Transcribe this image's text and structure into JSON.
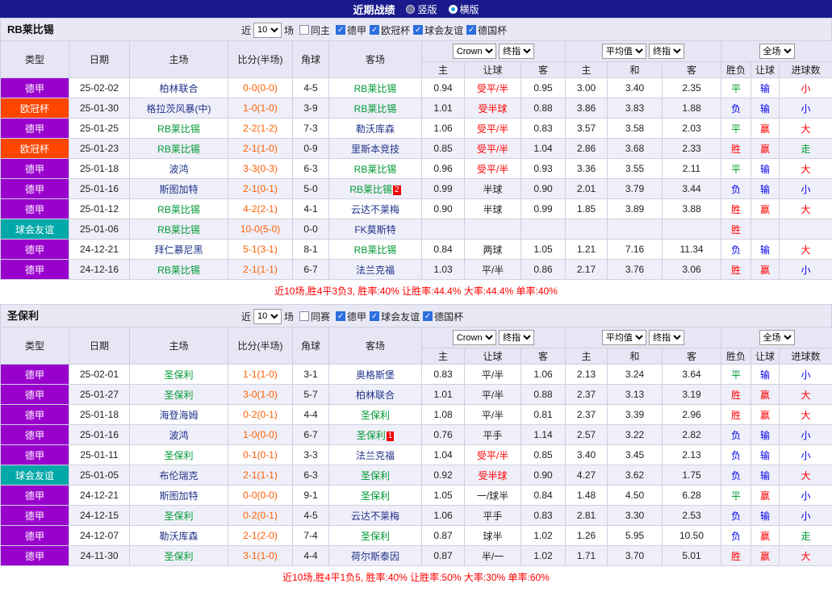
{
  "topbar": {
    "title": "近期战绩",
    "vertical": "竖版",
    "horizontal": "横版"
  },
  "league_colors": {
    "德甲": "#9900CC",
    "欧冠杯": "#FF4500",
    "球会友谊": "#00A8A8"
  },
  "headers": {
    "league": "类型",
    "date": "日期",
    "home": "主场",
    "score": "比分(半场)",
    "corner": "角球",
    "away": "客场",
    "a_home": "主",
    "a_handicap": "让球",
    "a_away": "客",
    "e_home": "主",
    "e_draw": "和",
    "e_away": "客",
    "res": "胜负",
    "hres": "让球",
    "goal": "进球数"
  },
  "sections": [
    {
      "team": "RB莱比锡",
      "filter": {
        "near": "近",
        "count": "10",
        "games": "场",
        "same": "同主",
        "same_checked": false,
        "leagues": [
          {
            "label": "德甲",
            "checked": true
          },
          {
            "label": "欧冠杯",
            "checked": true
          },
          {
            "label": "球会友谊",
            "checked": true
          },
          {
            "label": "德国杯",
            "checked": true
          }
        ]
      },
      "selects": {
        "bookmaker": "Crown",
        "bk_mode": "终指",
        "euro": "平均值",
        "euro_mode": "终指",
        "scope": "全场"
      },
      "rows": [
        {
          "league": "德甲",
          "date": "25-02-02",
          "home": "柏林联合",
          "home_focus": false,
          "home_badge": "",
          "score": "0-0(0-0)",
          "corner": "4-5",
          "away": "RB莱比锡",
          "away_focus": true,
          "away_badge": "",
          "a_home": "0.94",
          "handicap": "受平/半",
          "handicap_red": true,
          "a_away": "0.95",
          "e_home": "3.00",
          "e_draw": "3.40",
          "e_away": "2.35",
          "res": "平",
          "res_c": "g",
          "hres": "输",
          "hres_c": "b",
          "goal": "小",
          "goal_c": "r"
        },
        {
          "league": "欧冠杯",
          "date": "25-01-30",
          "home": "格拉茨风暴(中)",
          "home_focus": false,
          "home_badge": "",
          "score": "1-0(1-0)",
          "corner": "3-9",
          "away": "RB莱比锡",
          "away_focus": true,
          "away_badge": "",
          "a_home": "1.01",
          "handicap": "受半球",
          "handicap_red": true,
          "a_away": "0.88",
          "e_home": "3.86",
          "e_draw": "3.83",
          "e_away": "1.88",
          "res": "负",
          "res_c": "b",
          "hres": "输",
          "hres_c": "b",
          "goal": "小",
          "goal_c": "b"
        },
        {
          "league": "德甲",
          "date": "25-01-25",
          "home": "RB莱比锡",
          "home_focus": true,
          "home_badge": "",
          "score": "2-2(1-2)",
          "corner": "7-3",
          "away": "勒沃库森",
          "away_focus": false,
          "away_badge": "",
          "a_home": "1.06",
          "handicap": "受平/半",
          "handicap_red": true,
          "a_away": "0.83",
          "e_home": "3.57",
          "e_draw": "3.58",
          "e_away": "2.03",
          "res": "平",
          "res_c": "g",
          "hres": "赢",
          "hres_c": "r",
          "goal": "大",
          "goal_c": "r"
        },
        {
          "league": "欧冠杯",
          "date": "25-01-23",
          "home": "RB莱比锡",
          "home_focus": true,
          "home_badge": "",
          "score": "2-1(1-0)",
          "corner": "0-9",
          "away": "里斯本竞技",
          "away_focus": false,
          "away_badge": "",
          "a_home": "0.85",
          "handicap": "受平/半",
          "handicap_red": true,
          "a_away": "1.04",
          "e_home": "2.86",
          "e_draw": "3.68",
          "e_away": "2.33",
          "res": "胜",
          "res_c": "r",
          "hres": "赢",
          "hres_c": "r",
          "goal": "走",
          "goal_c": "g"
        },
        {
          "league": "德甲",
          "date": "25-01-18",
          "home": "波鸿",
          "home_focus": false,
          "home_badge": "",
          "score": "3-3(0-3)",
          "corner": "6-3",
          "away": "RB莱比锡",
          "away_focus": true,
          "away_badge": "",
          "a_home": "0.96",
          "handicap": "受平/半",
          "handicap_red": true,
          "a_away": "0.93",
          "e_home": "3.36",
          "e_draw": "3.55",
          "e_away": "2.11",
          "res": "平",
          "res_c": "g",
          "hres": "输",
          "hres_c": "b",
          "goal": "大",
          "goal_c": "r"
        },
        {
          "league": "德甲",
          "date": "25-01-16",
          "home": "斯图加特",
          "home_focus": false,
          "home_badge": "",
          "score": "2-1(0-1)",
          "corner": "5-0",
          "away": "RB莱比锡",
          "away_focus": true,
          "away_badge": "2",
          "a_home": "0.99",
          "handicap": "半球",
          "handicap_red": false,
          "a_away": "0.90",
          "e_home": "2.01",
          "e_draw": "3.79",
          "e_away": "3.44",
          "res": "负",
          "res_c": "b",
          "hres": "输",
          "hres_c": "b",
          "goal": "小",
          "goal_c": "b"
        },
        {
          "league": "德甲",
          "date": "25-01-12",
          "home": "RB莱比锡",
          "home_focus": true,
          "home_badge": "",
          "score": "4-2(2-1)",
          "corner": "4-1",
          "away": "云达不莱梅",
          "away_focus": false,
          "away_badge": "",
          "a_home": "0.90",
          "handicap": "半球",
          "handicap_red": false,
          "a_away": "0.99",
          "e_home": "1.85",
          "e_draw": "3.89",
          "e_away": "3.88",
          "res": "胜",
          "res_c": "r",
          "hres": "赢",
          "hres_c": "r",
          "goal": "大",
          "goal_c": "r"
        },
        {
          "league": "球会友谊",
          "date": "25-01-06",
          "home": "RB莱比锡",
          "home_focus": true,
          "home_badge": "",
          "score": "10-0(5-0)",
          "corner": "0-0",
          "away": "FK莫斯特",
          "away_focus": false,
          "away_badge": "",
          "a_home": "",
          "handicap": "",
          "handicap_red": false,
          "a_away": "",
          "e_home": "",
          "e_draw": "",
          "e_away": "",
          "res": "胜",
          "res_c": "r",
          "hres": "",
          "hres_c": "",
          "goal": "",
          "goal_c": ""
        },
        {
          "league": "德甲",
          "date": "24-12-21",
          "home": "拜仁慕尼黑",
          "home_focus": false,
          "home_badge": "",
          "score": "5-1(3-1)",
          "corner": "8-1",
          "away": "RB莱比锡",
          "away_focus": true,
          "away_badge": "",
          "a_home": "0.84",
          "handicap": "两球",
          "handicap_red": false,
          "a_away": "1.05",
          "e_home": "1.21",
          "e_draw": "7.16",
          "e_away": "11.34",
          "res": "负",
          "res_c": "b",
          "hres": "输",
          "hres_c": "b",
          "goal": "大",
          "goal_c": "r"
        },
        {
          "league": "德甲",
          "date": "24-12-16",
          "home": "RB莱比锡",
          "home_focus": true,
          "home_badge": "",
          "score": "2-1(1-1)",
          "corner": "6-7",
          "away": "法兰克福",
          "away_focus": false,
          "away_badge": "",
          "a_home": "1.03",
          "handicap": "平/半",
          "handicap_red": false,
          "a_away": "0.86",
          "e_home": "2.17",
          "e_draw": "3.76",
          "e_away": "3.06",
          "res": "胜",
          "res_c": "r",
          "hres": "赢",
          "hres_c": "r",
          "goal": "小",
          "goal_c": "b"
        }
      ],
      "summary": "近10场,胜4平3负3, 胜率:40% 让胜率:44.4% 大率:44.4% 单率:40%"
    },
    {
      "team": "圣保利",
      "filter": {
        "near": "近",
        "count": "10",
        "games": "场",
        "same": "同赛",
        "same_checked": false,
        "leagues": [
          {
            "label": "德甲",
            "checked": true
          },
          {
            "label": "球会友谊",
            "checked": true
          },
          {
            "label": "德国杯",
            "checked": true
          }
        ]
      },
      "selects": {
        "bookmaker": "Crown",
        "bk_mode": "终指",
        "euro": "平均值",
        "euro_mode": "终指",
        "scope": "全场"
      },
      "rows": [
        {
          "league": "德甲",
          "date": "25-02-01",
          "home": "圣保利",
          "home_focus": true,
          "home_badge": "",
          "score": "1-1(1-0)",
          "corner": "3-1",
          "away": "奥格斯堡",
          "away_focus": false,
          "away_badge": "",
          "a_home": "0.83",
          "handicap": "平/半",
          "handicap_red": false,
          "a_away": "1.06",
          "e_home": "2.13",
          "e_draw": "3.24",
          "e_away": "3.64",
          "res": "平",
          "res_c": "g",
          "hres": "输",
          "hres_c": "b",
          "goal": "小",
          "goal_c": "b"
        },
        {
          "league": "德甲",
          "date": "25-01-27",
          "home": "圣保利",
          "home_focus": true,
          "home_badge": "",
          "score": "3-0(1-0)",
          "corner": "5-7",
          "away": "柏林联合",
          "away_focus": false,
          "away_badge": "",
          "a_home": "1.01",
          "handicap": "平/半",
          "handicap_red": false,
          "a_away": "0.88",
          "e_home": "2.37",
          "e_draw": "3.13",
          "e_away": "3.19",
          "res": "胜",
          "res_c": "r",
          "hres": "赢",
          "hres_c": "r",
          "goal": "大",
          "goal_c": "r"
        },
        {
          "league": "德甲",
          "date": "25-01-18",
          "home": "海登海姆",
          "home_focus": false,
          "home_badge": "",
          "score": "0-2(0-1)",
          "corner": "4-4",
          "away": "圣保利",
          "away_focus": true,
          "away_badge": "",
          "a_home": "1.08",
          "handicap": "平/半",
          "handicap_red": false,
          "a_away": "0.81",
          "e_home": "2.37",
          "e_draw": "3.39",
          "e_away": "2.96",
          "res": "胜",
          "res_c": "r",
          "hres": "赢",
          "hres_c": "r",
          "goal": "大",
          "goal_c": "r"
        },
        {
          "league": "德甲",
          "date": "25-01-16",
          "home": "波鸿",
          "home_focus": false,
          "home_badge": "",
          "score": "1-0(0-0)",
          "corner": "6-7",
          "away": "圣保利",
          "away_focus": true,
          "away_badge": "1",
          "a_home": "0.76",
          "handicap": "平手",
          "handicap_red": false,
          "a_away": "1.14",
          "e_home": "2.57",
          "e_draw": "3.22",
          "e_away": "2.82",
          "res": "负",
          "res_c": "b",
          "hres": "输",
          "hres_c": "b",
          "goal": "小",
          "goal_c": "b"
        },
        {
          "league": "德甲",
          "date": "25-01-11",
          "home": "圣保利",
          "home_focus": true,
          "home_badge": "",
          "score": "0-1(0-1)",
          "corner": "3-3",
          "away": "法兰克福",
          "away_focus": false,
          "away_badge": "",
          "a_home": "1.04",
          "handicap": "受平/半",
          "handicap_red": true,
          "a_away": "0.85",
          "e_home": "3.40",
          "e_draw": "3.45",
          "e_away": "2.13",
          "res": "负",
          "res_c": "b",
          "hres": "输",
          "hres_c": "b",
          "goal": "小",
          "goal_c": "b"
        },
        {
          "league": "球会友谊",
          "date": "25-01-05",
          "home": "布伦瑞克",
          "home_focus": false,
          "home_badge": "",
          "score": "2-1(1-1)",
          "corner": "6-3",
          "away": "圣保利",
          "away_focus": true,
          "away_badge": "",
          "a_home": "0.92",
          "handicap": "受半球",
          "handicap_red": true,
          "a_away": "0.90",
          "e_home": "4.27",
          "e_draw": "3.62",
          "e_away": "1.75",
          "res": "负",
          "res_c": "b",
          "hres": "输",
          "hres_c": "b",
          "goal": "大",
          "goal_c": "r"
        },
        {
          "league": "德甲",
          "date": "24-12-21",
          "home": "斯图加特",
          "home_focus": false,
          "home_badge": "",
          "score": "0-0(0-0)",
          "corner": "9-1",
          "away": "圣保利",
          "away_focus": true,
          "away_badge": "",
          "a_home": "1.05",
          "handicap": "一/球半",
          "handicap_red": false,
          "a_away": "0.84",
          "e_home": "1.48",
          "e_draw": "4.50",
          "e_away": "6.28",
          "res": "平",
          "res_c": "g",
          "hres": "赢",
          "hres_c": "r",
          "goal": "小",
          "goal_c": "b"
        },
        {
          "league": "德甲",
          "date": "24-12-15",
          "home": "圣保利",
          "home_focus": true,
          "home_badge": "",
          "score": "0-2(0-1)",
          "corner": "4-5",
          "away": "云达不莱梅",
          "away_focus": false,
          "away_badge": "",
          "a_home": "1.06",
          "handicap": "平手",
          "handicap_red": false,
          "a_away": "0.83",
          "e_home": "2.81",
          "e_draw": "3.30",
          "e_away": "2.53",
          "res": "负",
          "res_c": "b",
          "hres": "输",
          "hres_c": "b",
          "goal": "小",
          "goal_c": "b"
        },
        {
          "league": "德甲",
          "date": "24-12-07",
          "home": "勒沃库森",
          "home_focus": false,
          "home_badge": "",
          "score": "2-1(2-0)",
          "corner": "7-4",
          "away": "圣保利",
          "away_focus": true,
          "away_badge": "",
          "a_home": "0.87",
          "handicap": "球半",
          "handicap_red": false,
          "a_away": "1.02",
          "e_home": "1.26",
          "e_draw": "5.95",
          "e_away": "10.50",
          "res": "负",
          "res_c": "b",
          "hres": "赢",
          "hres_c": "r",
          "goal": "走",
          "goal_c": "g"
        },
        {
          "league": "德甲",
          "date": "24-11-30",
          "home": "圣保利",
          "home_focus": true,
          "home_badge": "",
          "score": "3-1(1-0)",
          "corner": "4-4",
          "away": "荷尔斯泰因",
          "away_focus": false,
          "away_badge": "",
          "a_home": "0.87",
          "handicap": "半/一",
          "handicap_red": false,
          "a_away": "1.02",
          "e_home": "1.71",
          "e_draw": "3.70",
          "e_away": "5.01",
          "res": "胜",
          "res_c": "r",
          "hres": "赢",
          "hres_c": "r",
          "goal": "大",
          "goal_c": "r"
        }
      ],
      "summary": "近10场,胜4平1负5, 胜率:40% 让胜率:50% 大率:30% 单率:60%"
    }
  ]
}
